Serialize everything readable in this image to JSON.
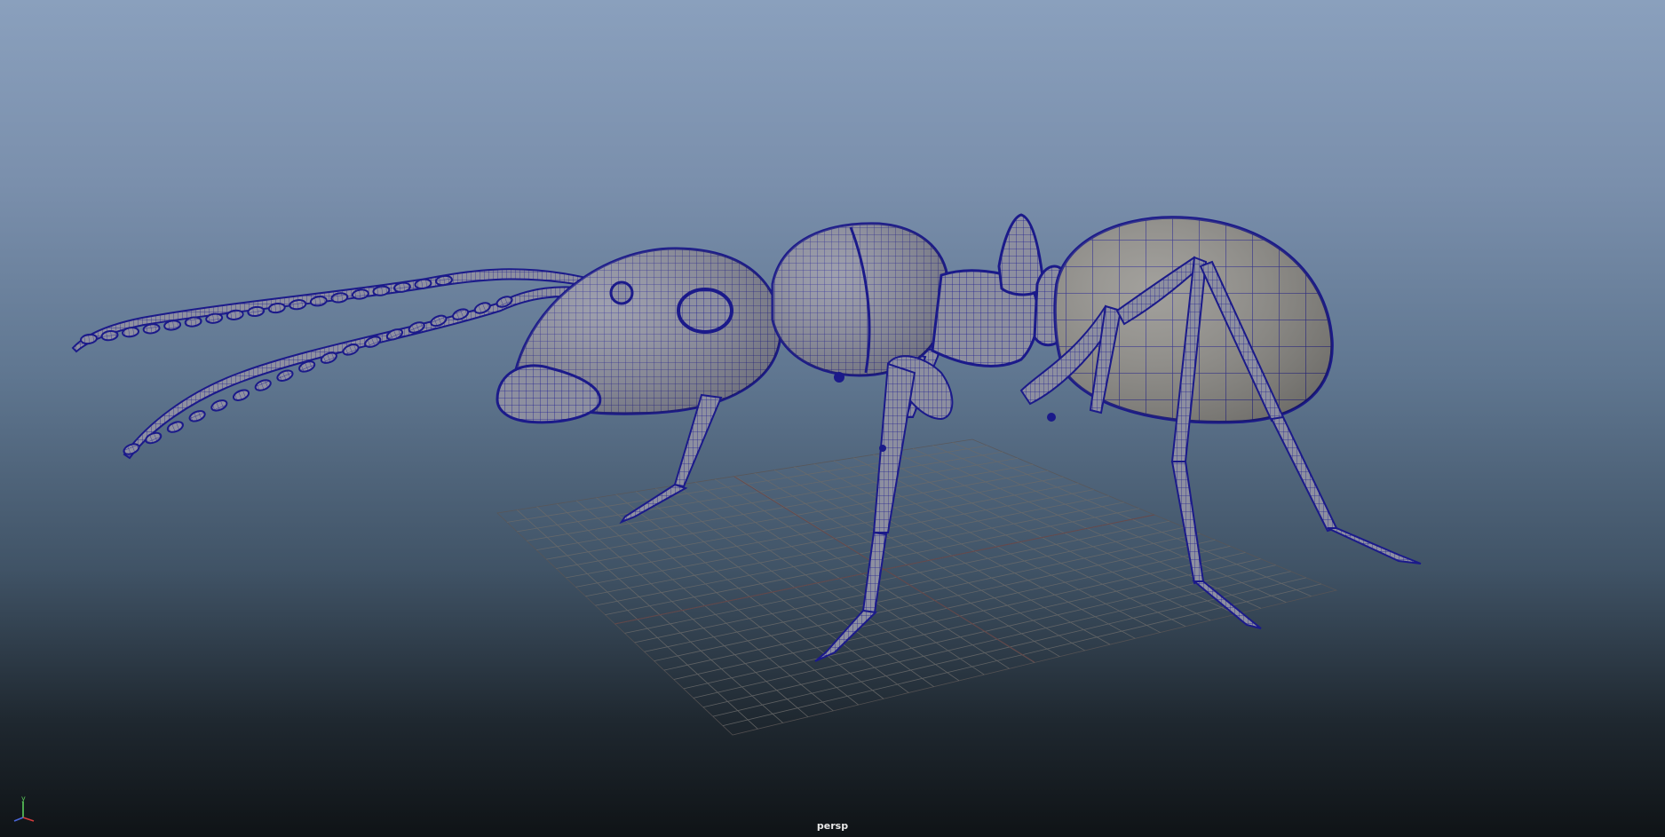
{
  "viewport": {
    "camera_name": "persp",
    "display_mode": "wireframe-on-shaded",
    "wireframe_color": "#1b1a8a",
    "mesh_color": "#8d8fa0",
    "background_top": "#8aa0bd",
    "background_bottom": "#0f1316"
  },
  "axis_gizmo": {
    "y_label": "y",
    "x_color": "#d43b3b",
    "y_color": "#5ccc5c",
    "z_color": "#4a66d8"
  },
  "model": {
    "subject": "ant"
  }
}
